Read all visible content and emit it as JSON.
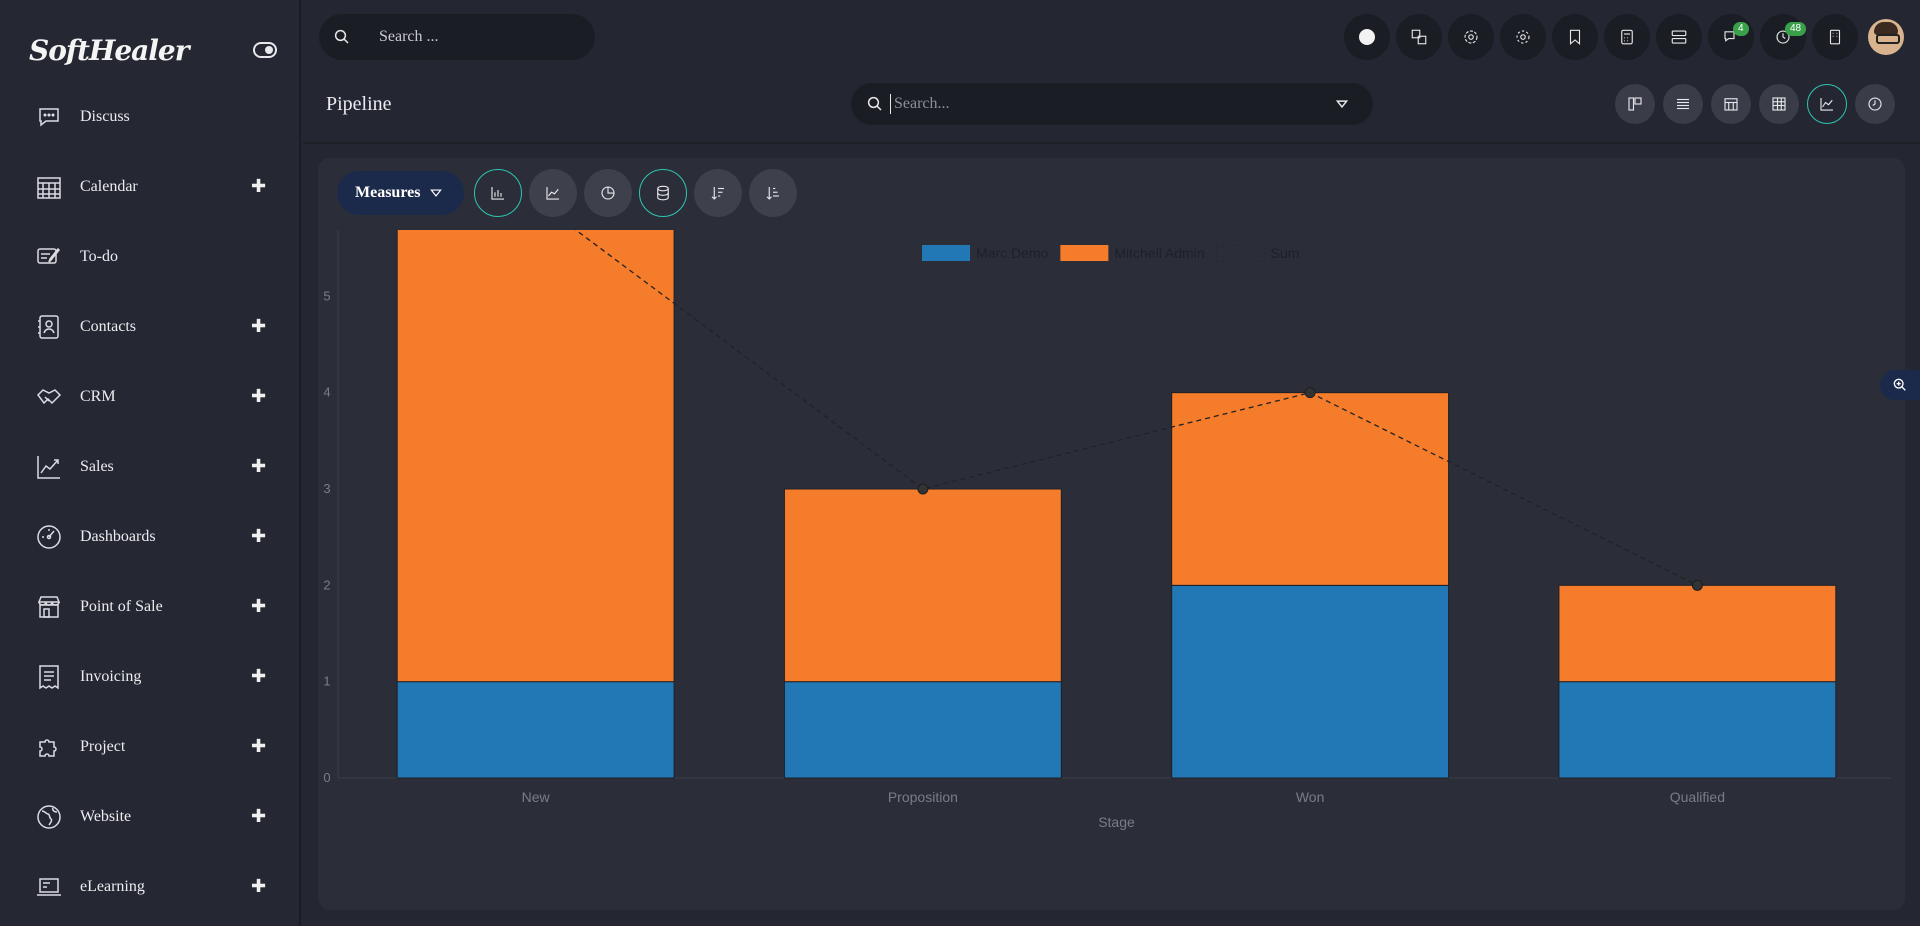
{
  "app": {
    "brand": "SoftHealer"
  },
  "topbar": {
    "search_placeholder": "Search ...",
    "badges": {
      "messages": "4",
      "activities": "48"
    }
  },
  "sidebar": {
    "items": [
      {
        "label": "Discuss",
        "icon": "chat-icon",
        "expandable": false
      },
      {
        "label": "Calendar",
        "icon": "calendar-icon",
        "expandable": true
      },
      {
        "label": "To-do",
        "icon": "todo-icon",
        "expandable": false
      },
      {
        "label": "Contacts",
        "icon": "contacts-icon",
        "expandable": true
      },
      {
        "label": "CRM",
        "icon": "handshake-icon",
        "expandable": true
      },
      {
        "label": "Sales",
        "icon": "chart-line-icon",
        "expandable": true
      },
      {
        "label": "Dashboards",
        "icon": "gauge-icon",
        "expandable": true
      },
      {
        "label": "Point of Sale",
        "icon": "store-icon",
        "expandable": true
      },
      {
        "label": "Invoicing",
        "icon": "receipt-icon",
        "expandable": true
      },
      {
        "label": "Project",
        "icon": "puzzle-icon",
        "expandable": true
      },
      {
        "label": "Website",
        "icon": "globe-icon",
        "expandable": true
      },
      {
        "label": "eLearning",
        "icon": "laptop-icon",
        "expandable": true
      }
    ],
    "plus_glyph": "✚"
  },
  "control_panel": {
    "title": "Pipeline",
    "search_placeholder": "Search..."
  },
  "toolbar": {
    "measures_label": "Measures"
  },
  "colors": {
    "accent": "#2ec5b2",
    "series_a": "#2278b5",
    "series_b": "#f57c2a",
    "sum_line": "#222222"
  },
  "chart_data": {
    "type": "bar",
    "stacked": true,
    "categories": [
      "New",
      "Proposition",
      "Won",
      "Qualified"
    ],
    "series": [
      {
        "name": "Marc Demo",
        "values": [
          1,
          1,
          2,
          1
        ]
      },
      {
        "name": "Mitchell Admin",
        "values": [
          5,
          2,
          2,
          1
        ]
      }
    ],
    "sum": {
      "name": "Sum",
      "values": [
        6,
        3,
        4,
        2
      ],
      "style": "dashed-line"
    },
    "xlabel": "Stage",
    "ylabel": "",
    "ylim": [
      0,
      6
    ],
    "yticks": [
      0,
      1,
      2,
      3,
      4,
      5,
      6
    ],
    "legend": "top-center",
    "grid": false
  }
}
